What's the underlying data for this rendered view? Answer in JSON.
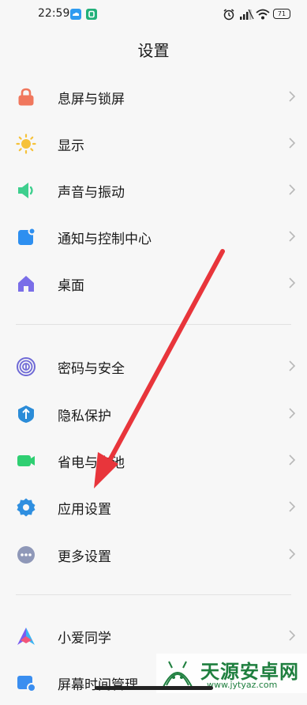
{
  "status_bar": {
    "time": "22:59",
    "battery": "71"
  },
  "header": {
    "title": "设置"
  },
  "sections": [
    {
      "items": [
        {
          "label": "息屏与锁屏",
          "icon": "lock-icon",
          "color": "#f0775d"
        },
        {
          "label": "显示",
          "icon": "sun-icon",
          "color": "#f6c23a"
        },
        {
          "label": "声音与振动",
          "icon": "speaker-icon",
          "color": "#3ecf8e"
        },
        {
          "label": "通知与控制中心",
          "icon": "notification-icon",
          "color": "#2e8ff0"
        },
        {
          "label": "桌面",
          "icon": "home-icon",
          "color": "#7a6ee8"
        }
      ]
    },
    {
      "items": [
        {
          "label": "密码与安全",
          "icon": "fingerprint-icon",
          "color": "#6f6ad6"
        },
        {
          "label": "隐私保护",
          "icon": "privacy-icon",
          "color": "#2b8cd8"
        },
        {
          "label": "省电与电池",
          "icon": "battery-icon",
          "color": "#2fcf72"
        },
        {
          "label": "应用设置",
          "icon": "gear-icon",
          "color": "#2f8fe0"
        },
        {
          "label": "更多设置",
          "icon": "more-icon",
          "color": "#8f98b8"
        }
      ]
    },
    {
      "items": [
        {
          "label": "小爱同学",
          "icon": "xiaoai-icon",
          "color": "#4c8cf5"
        },
        {
          "label": "屏幕时间管理",
          "icon": "screen-time-icon",
          "color": "#3a8ef0"
        }
      ]
    }
  ],
  "watermark": {
    "brand": "天源安卓网",
    "url": "www.jytyaz.com"
  },
  "colors": {
    "accent_arrow": "#e8353b",
    "chevron": "#b8b8b8"
  }
}
